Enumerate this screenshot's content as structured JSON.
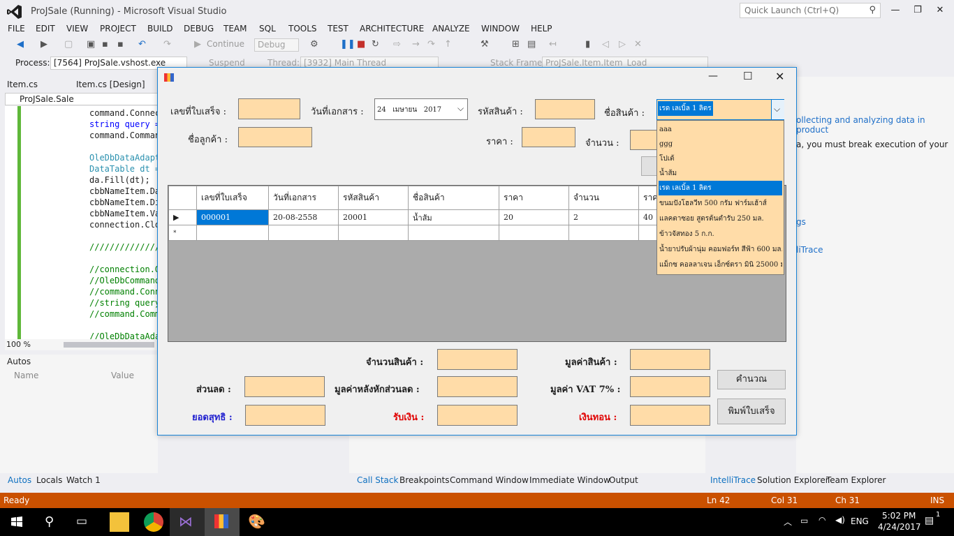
{
  "app": {
    "title": "ProJSale (Running) - Microsoft Visual Studio",
    "quick_launch_placeholder": "Quick Launch (Ctrl+Q)"
  },
  "menu": [
    "FILE",
    "EDIT",
    "VIEW",
    "PROJECT",
    "BUILD",
    "DEBUG",
    "TEAM",
    "SQL",
    "TOOLS",
    "TEST",
    "ARCHITECTURE",
    "ANALYZE",
    "WINDOW",
    "HELP"
  ],
  "toolbar": {
    "continue_label": "Continue",
    "config_value": "Debug",
    "process_label": "Process:",
    "process_value": "[7564] ProJSale.vshost.exe",
    "suspend_label": "Suspend",
    "thread_label": "Thread:",
    "thread_value": "[3932] Main Thread",
    "stackframe_label": "Stack Frame:",
    "stackframe_value": "ProJSale.Item.Item_Load"
  },
  "doc_tabs": [
    "Item.cs",
    "Item.cs [Design]"
  ],
  "nav_bar": "ProJSale.Sale",
  "code_lines": [
    "command.Connec",
    "string query =",
    "command.Comman",
    "",
    "OleDbDataAdapt",
    "DataTable dt =",
    "da.Fill(dt);",
    "cbbNameItem.Da",
    "cbbNameItem.Di",
    "cbbNameItem.Va",
    "connection.Clo",
    "",
    "//////////////",
    "",
    "//connection.O",
    "//OleDbCommand",
    "//command.Conn",
    "//string query",
    "//command.Comm",
    "",
    "//OleDbDataAda"
  ],
  "zoom": "100 %",
  "autos": {
    "title": "Autos",
    "col_name": "Name",
    "col_value": "Value"
  },
  "right_panel": {
    "line1": "ollecting and analyzing data in product",
    "line2": "a, you must break execution of your",
    "link1": "gs",
    "link2": "liTrace"
  },
  "bottom_tabs_left": [
    "Autos",
    "Locals",
    "Watch 1"
  ],
  "bottom_tabs_mid": [
    "Call Stack",
    "Breakpoints",
    "Command Window",
    "Immediate Window",
    "Output"
  ],
  "bottom_tabs_right": [
    "IntelliTrace",
    "Solution Explorer",
    "Team Explorer"
  ],
  "status": {
    "text": "Ready",
    "ln": "Ln 42",
    "col": "Col 31",
    "ch": "Ch 31",
    "ins": "INS"
  },
  "taskbar": {
    "lang": "ENG",
    "time": "5:02 PM",
    "date": "4/24/2017",
    "notif_count": "1"
  },
  "form": {
    "labels": {
      "receipt_no": "เลขที่ใบเสร็จ :",
      "doc_date": "วันที่เอกสาร :",
      "product_code": "รหัสสินค้า :",
      "product_name": "ชื่อสินค้า :",
      "customer_name": "ชื่อลูกค้า :",
      "price": "ราคา :",
      "quantity": "จำนวน :",
      "total_qty": "จำนวนสินค้า :",
      "product_value": "มูลค่าสินค้า :",
      "discount": "ส่วนลด :",
      "after_discount": "มูลค่าหลังหักส่วนลด :",
      "vat": "มูลค่า VAT 7% :",
      "net_total": "ยอดสุทธิ :",
      "received": "รับเงิน :",
      "change": "เงินทอน :"
    },
    "date_value": "24   เมษายน   2017",
    "combo_selected": "เรด เลเบิ้ล 1 ลิตร",
    "buttons": {
      "calculate": "คำนวณ",
      "print": "พิมพ์ใบเสร็จ"
    },
    "grid": {
      "headers": [
        "เลขที่ใบเสร็จ",
        "วันที่เอกสาร",
        "รหัสสินค้า",
        "ชื่อสินค้า",
        "ราคา",
        "จำนวน",
        "ราค"
      ],
      "rows": [
        [
          "000001",
          "20-08-2558",
          "20001",
          "น้ำส้ม",
          "20",
          "2",
          "40"
        ]
      ]
    },
    "dropdown_items": [
      "aaa",
      "ggg",
      "โปเต้",
      "น้ำส้ม",
      "เรด เลเบิ้ล 1 ลิตร",
      "ขนมปังโฮลวีท 500 กรัม ฟาร์มเฮ้าส์",
      "แลคตาซอย สูตรต้นตำรับ 250 มล.",
      "ข้าวจัสทอง 5 ก.ก.",
      "น้ำยาปรับผ้านุ่ม คอมฟอร์ท สีฟ้า 600 มล.",
      "แม็กซ คอลลาเจน เอ็กซ์ตรา มินิ 25000 มก."
    ],
    "dropdown_selected_index": 4
  }
}
